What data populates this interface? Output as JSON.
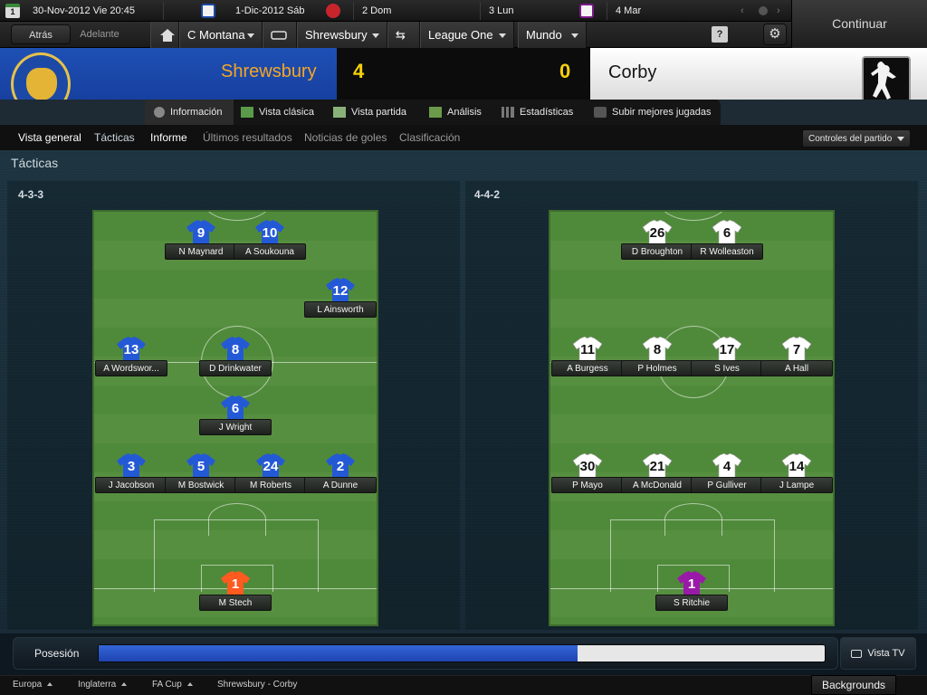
{
  "topbar": {
    "date": "30-Nov-2012",
    "day": "Vie",
    "time": "20:45",
    "calendar_day": "1",
    "upcoming": [
      {
        "label": "1-Dic-2012 Sáb"
      },
      {
        "label": "2 Dom"
      },
      {
        "label": "3 Lun"
      },
      {
        "label": "4 Mar"
      }
    ]
  },
  "nav": {
    "back": "Atrás",
    "forward": "Adelante",
    "manager": "C Montana",
    "club": "Shrewsbury",
    "league": "League One",
    "world": "Mundo",
    "help": "?",
    "continue": "Continuar"
  },
  "match": {
    "home_team": "Shrewsbury",
    "away_team": "Corby",
    "home_score": "4",
    "away_score": "0"
  },
  "tabs": [
    "Información",
    "Vista clásica",
    "Vista partida",
    "Análisis",
    "Estadísticas",
    "Subir mejores jugadas"
  ],
  "subnav": [
    "Vista general",
    "Tácticas",
    "Informe",
    "Últimos resultados",
    "Noticias de goles",
    "Clasificación"
  ],
  "match_controls": "Controles del partido",
  "section_title": "Tácticas",
  "home": {
    "formation": "4-3-3",
    "players": [
      {
        "num": "9",
        "name": "N Maynard"
      },
      {
        "num": "10",
        "name": "A Soukouna"
      },
      {
        "num": "12",
        "name": "L Ainsworth"
      },
      {
        "num": "13",
        "name": "A Wordswor..."
      },
      {
        "num": "8",
        "name": "D Drinkwater"
      },
      {
        "num": "6",
        "name": "J Wright"
      },
      {
        "num": "3",
        "name": "J Jacobson"
      },
      {
        "num": "5",
        "name": "M Bostwick"
      },
      {
        "num": "24",
        "name": "M Roberts"
      },
      {
        "num": "2",
        "name": "A Dunne"
      },
      {
        "num": "1",
        "name": "M Stech"
      }
    ]
  },
  "away": {
    "formation": "4-4-2",
    "players": [
      {
        "num": "26",
        "name": "D Broughton"
      },
      {
        "num": "6",
        "name": "R Wolleaston"
      },
      {
        "num": "11",
        "name": "A Burgess"
      },
      {
        "num": "8",
        "name": "P Holmes"
      },
      {
        "num": "17",
        "name": "S Ives"
      },
      {
        "num": "7",
        "name": "A Hall"
      },
      {
        "num": "30",
        "name": "P Mayo"
      },
      {
        "num": "21",
        "name": "A McDonald"
      },
      {
        "num": "4",
        "name": "P Gulliver"
      },
      {
        "num": "14",
        "name": "J Lampe"
      },
      {
        "num": "1",
        "name": "S Ritchie"
      }
    ]
  },
  "possession": {
    "label": "Posesión",
    "home_fraction": 0.66
  },
  "vista_tv": "Vista TV",
  "footer": {
    "crumbs": [
      "Europa",
      "Inglaterra",
      "FA Cup",
      "Shrewsbury - Corby"
    ],
    "backgrounds": "Backgrounds"
  },
  "colors": {
    "home_blue": "#1e50b4",
    "score_yellow": "#f5d20a",
    "home_name": "#f5a623",
    "keeper_home": "#ff5a1f",
    "keeper_away": "#9a1aa8",
    "pitch": "#4f8a3a"
  }
}
